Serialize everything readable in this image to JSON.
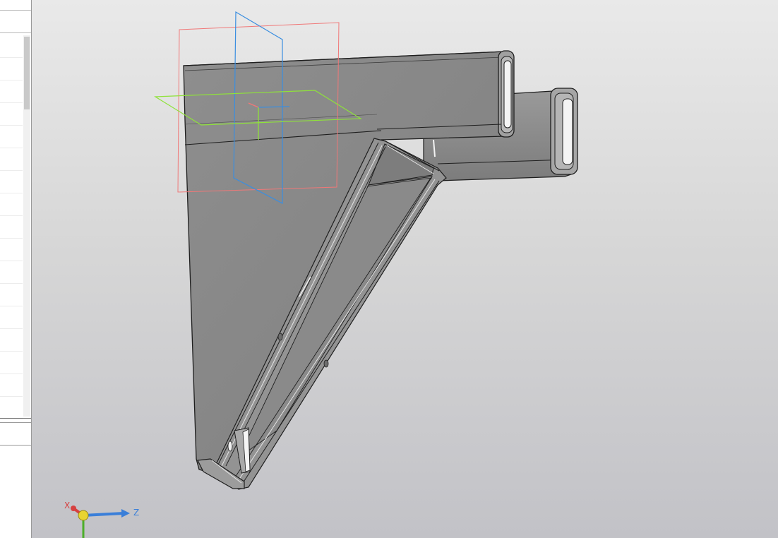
{
  "viewport": {
    "background_top": "#e9e9e9",
    "background_bottom": "#c2c2c7"
  },
  "planes": [
    {
      "name": "front-plane",
      "color": "#f07878"
    },
    {
      "name": "right-plane",
      "color": "#3a8ee0"
    },
    {
      "name": "top-plane",
      "color": "#8fe23a"
    }
  ],
  "model": {
    "body_color": "#8a8a8a",
    "edge_color": "#1e1e1e"
  },
  "triad": {
    "x_label": "X",
    "z_label": "Z",
    "x_color": "#d64040",
    "y_color": "#4cae2a",
    "z_color": "#3a7fd9",
    "origin_color": "#e8d430"
  }
}
